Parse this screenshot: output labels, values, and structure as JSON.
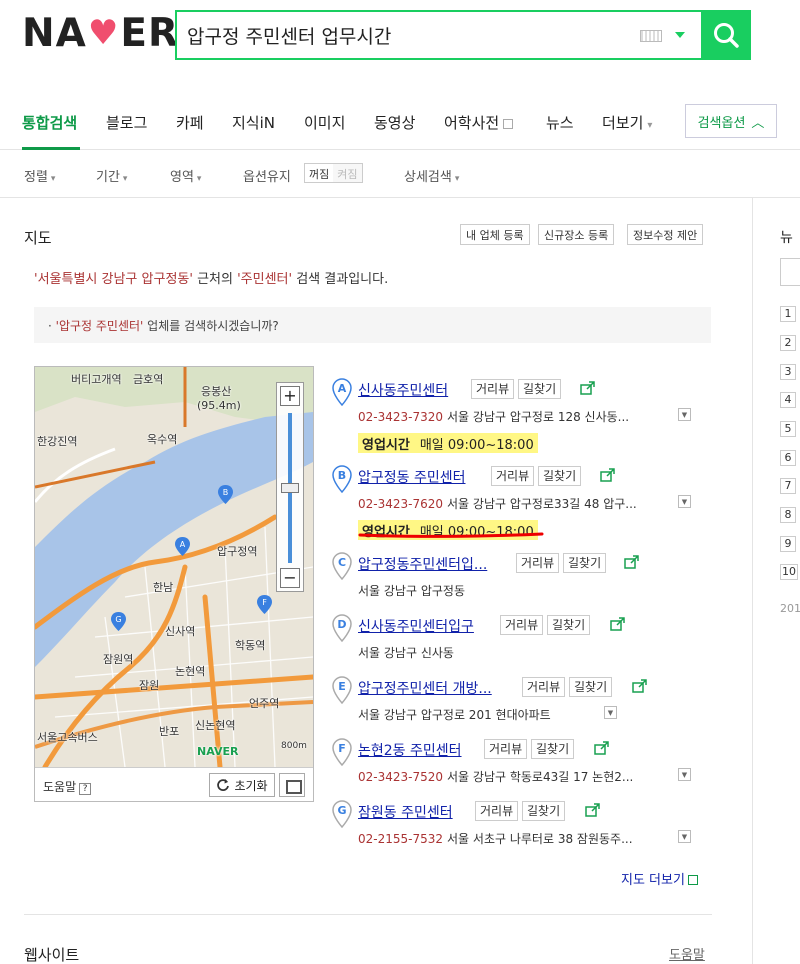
{
  "header": {
    "logo_text_left": "NA",
    "logo_text_right": "ER",
    "search_value": "압구정 주민센터 업무시간"
  },
  "tabs": [
    {
      "label": "통합검색",
      "active": true
    },
    {
      "label": "블로그"
    },
    {
      "label": "카페"
    },
    {
      "label": "지식iN"
    },
    {
      "label": "이미지"
    },
    {
      "label": "동영상"
    },
    {
      "label": "어학사전"
    },
    {
      "label": "뉴스"
    },
    {
      "label": "더보기"
    }
  ],
  "search_options_label": "검색옵션",
  "filters": {
    "sort": "정렬",
    "period": "기간",
    "area": "영역",
    "option_keep": "옵션유지",
    "toggle_off": "꺼짐",
    "toggle_on": "켜짐",
    "detail": "상세검색"
  },
  "map_section": {
    "title": "지도",
    "buttons": [
      "내 업체 등록",
      "신규장소 등록",
      "정보수정 제안"
    ],
    "notice_pre": "'서울특별시 강남구 압구정동'",
    "notice_mid": " 근처의 ",
    "notice_key": "'주민센터'",
    "notice_post": " 검색 결과입니다.",
    "suggest_dot": "·",
    "suggest_key": "'압구정 주민센터'",
    "suggest_post": " 업체를 검색하시겠습니까?",
    "more_label": "지도 더보기"
  },
  "map": {
    "labels": [
      "버티고개역",
      "금호역",
      "응봉산",
      "(95.4m)",
      "한강진역",
      "옥수역",
      "압구정역",
      "한남",
      "신사역",
      "학동역",
      "잠원역",
      "논현역",
      "잠원",
      "언주역",
      "반포",
      "신논현역",
      "서울고속버스",
      "NAVER",
      "800m"
    ],
    "help_label": "도움말",
    "help_q": "?",
    "reset_label": "초기화"
  },
  "results": [
    {
      "marker": "A",
      "name": "신사동주민센터",
      "chip1": "거리뷰",
      "chip2": "길찾기",
      "phone": "02-3423-7320",
      "address": "서울 강남구 압구정로 128 신사동...",
      "hours_label": "영업시간",
      "hours_value": "매일 09:00~18:00"
    },
    {
      "marker": "B",
      "name": "압구정동 주민센터",
      "chip1": "거리뷰",
      "chip2": "길찾기",
      "phone": "02-3423-7620",
      "address": "서울 강남구 압구정로33길 48 압구...",
      "hours_label": "영업시간",
      "hours_value": "매일 09:00~18:00"
    },
    {
      "marker": "C",
      "name": "압구정동주민센터입...",
      "chip1": "거리뷰",
      "chip2": "길찾기",
      "phone": "",
      "address": "서울 강남구 압구정동"
    },
    {
      "marker": "D",
      "name": "신사동주민센터입구",
      "chip1": "거리뷰",
      "chip2": "길찾기",
      "phone": "",
      "address": "서울 강남구 신사동"
    },
    {
      "marker": "E",
      "name": "압구정주민센터 개방...",
      "chip1": "거리뷰",
      "chip2": "길찾기",
      "phone": "",
      "address": "서울 강남구 압구정로 201 현대아파트"
    },
    {
      "marker": "F",
      "name": "논현2동 주민센터",
      "chip1": "거리뷰",
      "chip2": "길찾기",
      "phone": "02-3423-7520",
      "address": "서울 강남구 학동로43길 17 논현2..."
    },
    {
      "marker": "G",
      "name": "잠원동 주민센터",
      "chip1": "거리뷰",
      "chip2": "길찾기",
      "phone": "02-2155-7532",
      "address": "서울 서초구 나루터로 38 잠원동주..."
    }
  ],
  "website_section": {
    "title": "웹사이트",
    "help": "도움말"
  },
  "right_column": {
    "title_fragment": "뉴",
    "ranks": [
      "1",
      "2",
      "3",
      "4",
      "5",
      "6",
      "7",
      "8",
      "9",
      "10"
    ],
    "foot_fragment": "201"
  },
  "colors": {
    "brand_green": "#19ce60",
    "active_tab": "#0e9a48",
    "link_blue": "#1122aa",
    "phone_red": "#a33333",
    "highlight_yellow": "#fff785"
  }
}
